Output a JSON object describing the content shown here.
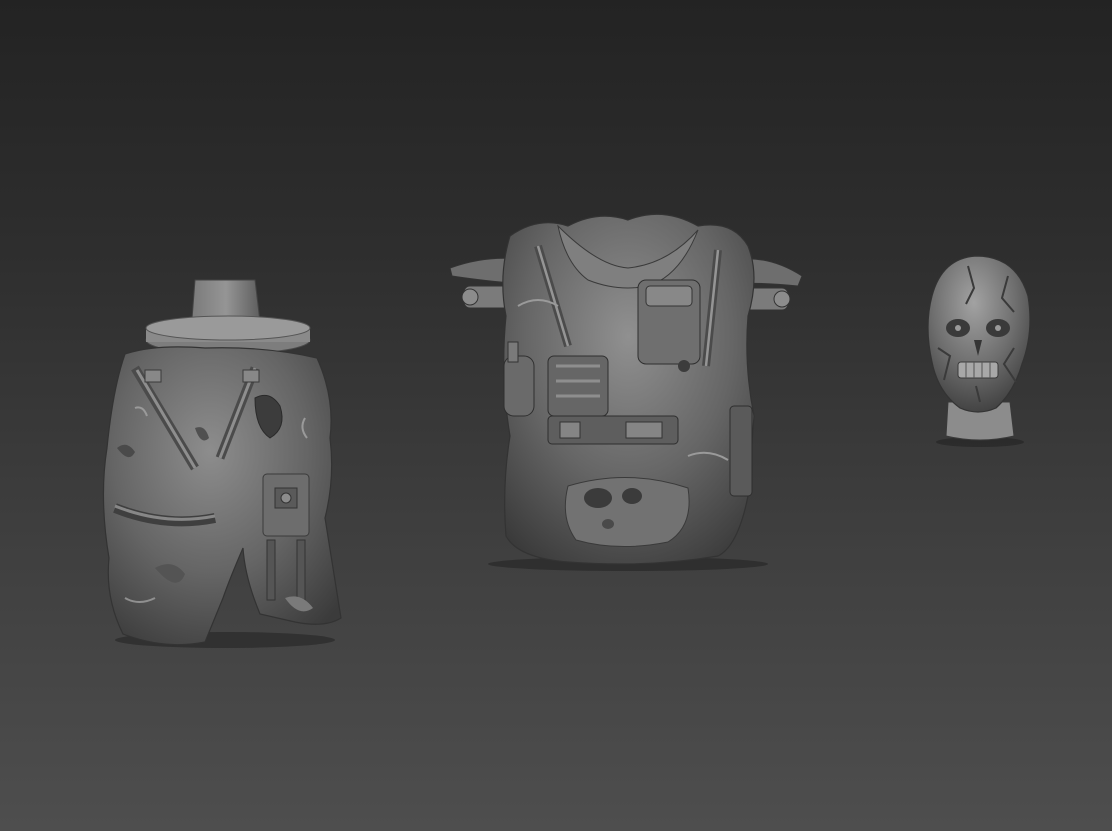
{
  "viewport": {
    "background_top": "#232323",
    "background_bottom": "#4e4e4e",
    "material_color": "#6b6b6b"
  },
  "models": [
    {
      "name": "legs-sculpt"
    },
    {
      "name": "torso-vest-sculpt"
    },
    {
      "name": "head-sculpt"
    }
  ]
}
